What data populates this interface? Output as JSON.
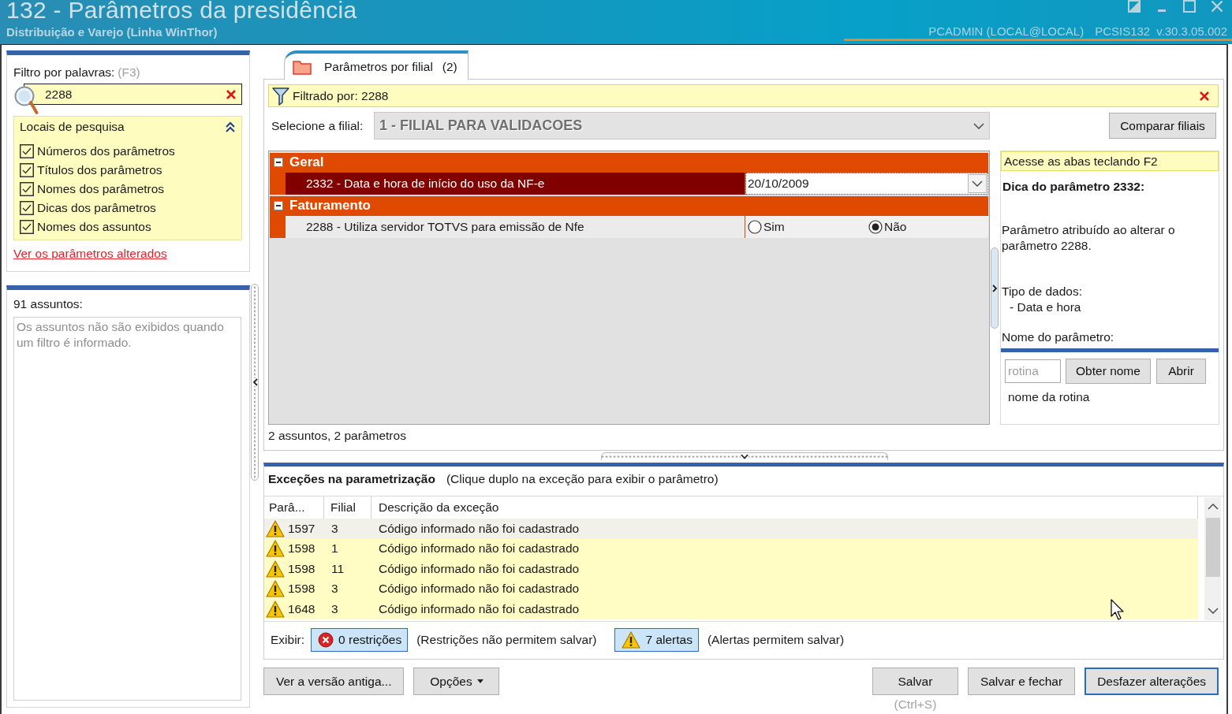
{
  "window": {
    "title": "132 - Parâmetros da presidência",
    "subtitle": "Distribuição e Varejo (Linha WinThor)",
    "user": "PCADMIN (LOCAL@LOCAL)",
    "program": "PCSIS132",
    "version": "v.30.3.05.002"
  },
  "filter_panel": {
    "label": "Filtro por palavras:",
    "shortcut": "(F3)",
    "search": {
      "value": "2288"
    },
    "search_locations": {
      "title": "Locais de pesquisa",
      "expanded": true,
      "options": [
        {
          "label": "Números dos parâmetros",
          "checked": true
        },
        {
          "label": "Títulos dos parâmetros",
          "checked": true
        },
        {
          "label": "Nomes dos parâmetros",
          "checked": true
        },
        {
          "label": "Dicas dos parâmetros",
          "checked": true
        },
        {
          "label": "Nomes dos assuntos",
          "checked": true
        }
      ]
    },
    "link": "Ver os parâmetros alterados"
  },
  "subjects_panel": {
    "count": "91 assuntos:",
    "message": "Os assuntos não são exibidos quando um filtro é informado."
  },
  "tabs": [
    {
      "label": "Parâmetros por filial",
      "count": "(2)",
      "selected": true
    }
  ],
  "filter_bar": {
    "text": "Filtrado por: 2288"
  },
  "branch_select": {
    "label": "Selecione a filial:",
    "value": "1 - FILIAL PARA VALIDACOES",
    "disabled": true
  },
  "compare_button": "Comparar filiais",
  "parameter_groups": [
    {
      "name": "Geral",
      "expanded": true,
      "parameters": [
        {
          "label": "2332 - Data e hora de início do uso da NF-e",
          "selected": true,
          "kind": "date",
          "value": "20/10/2009"
        }
      ]
    },
    {
      "name": "Faturamento",
      "expanded": true,
      "parameters": [
        {
          "label": "2288 - Utiliza servidor TOTVS para emissão de Nfe",
          "selected": false,
          "kind": "radio",
          "options": [
            {
              "label": "Sim",
              "selected": false
            },
            {
              "label": "Não",
              "selected": true
            }
          ]
        }
      ]
    }
  ],
  "hint_panel": {
    "tip": "Acesse as abas teclando F2",
    "title": "Dica do parâmetro 2332:",
    "description": "Parâmetro atribuído ao alterar o parâmetro 2288.",
    "data_type_label": "Tipo de dados:",
    "data_type": "- Data e hora",
    "name_label": "Nome do parâmetro:",
    "routine_field": {
      "placeholder": "rotina"
    },
    "buttons": [
      "Obter nome",
      "Abrir"
    ],
    "routine_name": "nome da rotina"
  },
  "summary": "2 assuntos, 2 parâmetros",
  "exceptions": {
    "title": "Exceções na parametrização",
    "hint": "(Clique duplo na exceção para exibir o parâmetro)",
    "columns": [
      "Parâ...",
      "Filial",
      "Descrição da exceção"
    ],
    "rows": [
      {
        "parameter": "1597",
        "branch": "3",
        "description": "Código informado não foi cadastrado",
        "selected": true
      },
      {
        "parameter": "1598",
        "branch": "1",
        "description": "Código informado não foi cadastrado",
        "selected": false
      },
      {
        "parameter": "1598",
        "branch": "11",
        "description": "Código informado não foi cadastrado",
        "selected": false
      },
      {
        "parameter": "1598",
        "branch": "3",
        "description": "Código informado não foi cadastrado",
        "selected": false
      },
      {
        "parameter": "1648",
        "branch": "3",
        "description": "Código informado não foi cadastrado",
        "selected": false
      }
    ],
    "show_label": "Exibir:",
    "filters": [
      {
        "label": "0 restrições",
        "kind": "restriction",
        "on": true,
        "note": "(Restrições não permitem salvar)"
      },
      {
        "label": "7 alertas",
        "kind": "alert",
        "on": true,
        "note": "(Alertas permitem salvar)"
      }
    ]
  },
  "footer": {
    "left_buttons": [
      {
        "label": "Ver a versão antiga...",
        "dropdown": false,
        "focused": false
      },
      {
        "label": "Opções",
        "dropdown": true,
        "focused": false
      }
    ],
    "right_buttons": [
      {
        "label": "Salvar",
        "dropdown": false,
        "focused": false,
        "shortcut": "(Ctrl+S)"
      },
      {
        "label": "Salvar e fechar",
        "dropdown": false,
        "focused": false
      },
      {
        "label": "Desfazer alterações",
        "dropdown": false,
        "focused": true
      }
    ]
  }
}
